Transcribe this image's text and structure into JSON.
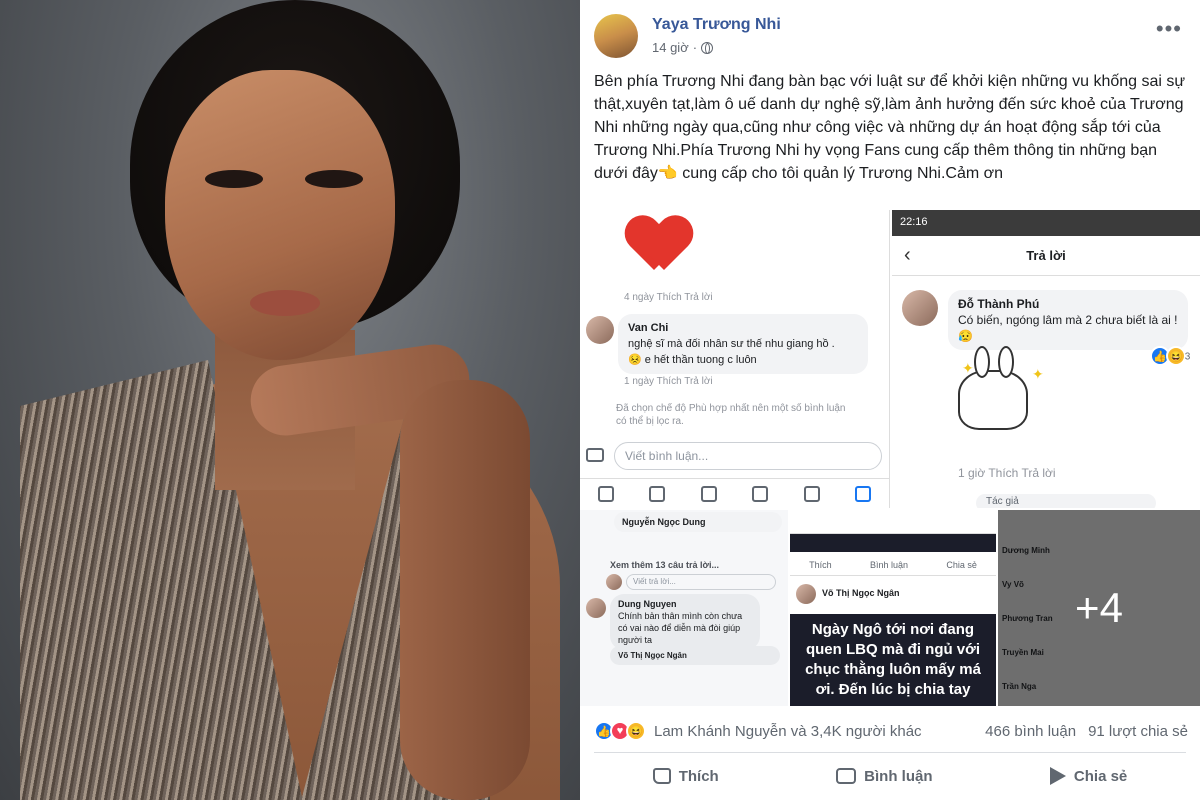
{
  "post": {
    "author": "Yaya Trương Nhi",
    "time": "14 giờ",
    "more_icon": "more-icon",
    "text": "Bên phía Trương Nhi đang bàn bạc với luật sư để khởi kiện những vu khống sai sự thật,xuyên tạt,làm ô uế danh dự nghệ sỹ,làm ảnh hưởng đến sức khoẻ của Trương Nhi những ngày qua,cũng như công việc và những dự án hoạt động sắp tới của Trương Nhi.Phía Trương Nhi hy vọng Fans cung cấp thêm thông tin những bạn dưới đây👈 cung cấp cho tôi quản lý Trương Nhi.Cảm ơn"
  },
  "screens": {
    "s1": {
      "meta1": "4 ngày   Thích   Trả lời",
      "name": "Van Chi",
      "comment": "nghệ sĩ mà đối nhân sư thế nhu giang hồ .\n😣 e hết thần tuong c luôn",
      "meta2": "1 ngày   Thích   Trả lời",
      "filter_note": "Đã chọn chế độ Phù hợp nhất nên một số bình luận có thể bị lọc ra.",
      "input_placeholder": "Viết bình luận..."
    },
    "s2": {
      "status_time": "22:16",
      "title": "Trả lời",
      "name": "Đỗ Thành Phú",
      "comment": "Có biến, ngóng lâm mà 2 chưa biết là ai !😥",
      "count": "3",
      "meta": "1 giờ    Thích    Trả lời",
      "author_tag": "Tác giả"
    },
    "s3": {
      "name1": "Nguyễn Ngọc Dung",
      "view_more": "Xem thêm 13 câu trả lời...",
      "placeholder": "Viết trả lời...",
      "name2": "Dung Nguyen",
      "comment2": "Chính bản thân mình còn chưa có vai nào để diễn mà đòi giúp người ta",
      "name3": "Võ Thị Ngọc Ngân"
    },
    "s4": {
      "like": "Thích",
      "comment": "Bình luận",
      "share": "Chia sẻ",
      "name": "Võ Thị Ngọc Ngân",
      "card_text": "Ngày Ngô tới nơi đang quen LBQ mà đi ngủ với chục thằng luôn mấy má ơi. Đến lúc bị chia tay"
    },
    "s5": {
      "names": [
        "Dương Minh",
        "Vy Võ",
        "Phương Tran",
        "Truyền Mai",
        "Trần Nga"
      ],
      "overlay": "+4"
    }
  },
  "reactions": {
    "names": "Lam Khánh Nguyễn và 3,4K người khác",
    "comments": "466 bình luận",
    "shares": "91 lượt chia sẻ"
  },
  "actions": {
    "like": "Thích",
    "comment": "Bình luận",
    "share": "Chia sẻ"
  },
  "colors": {
    "link_blue": "#385898",
    "like": "#1877f2",
    "love": "#f33e58",
    "haha": "#f7b928"
  }
}
